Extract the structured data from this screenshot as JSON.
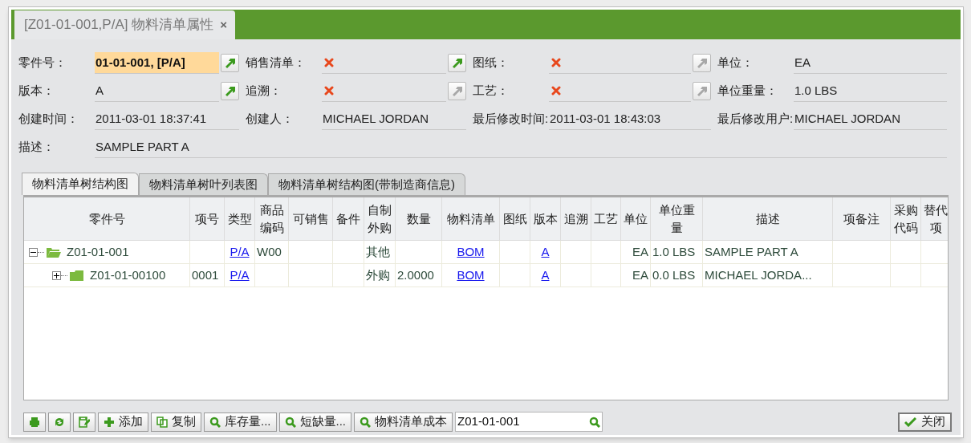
{
  "window": {
    "title": "[Z01-01-001,P/A] 物料清单属性",
    "close": "×"
  },
  "form": {
    "rows": [
      [
        {
          "label": "零件号：",
          "value": "01-01-001, [P/A]",
          "highlight": true,
          "link": {
            "disabled": false
          }
        },
        {
          "label": "销售清单：",
          "empty": true,
          "link": {
            "disabled": false
          }
        },
        {
          "label": "图纸：",
          "empty": true,
          "link": {
            "disabled": true
          }
        },
        {
          "label": "单位：",
          "value": "EA"
        }
      ],
      [
        {
          "label": "版本：",
          "value": "A",
          "link": {
            "disabled": false
          }
        },
        {
          "label": "追溯：",
          "empty": true,
          "link": {
            "disabled": true
          }
        },
        {
          "label": "工艺：",
          "empty": true,
          "link": {
            "disabled": true
          }
        },
        {
          "label": "单位重量：",
          "value": "1.0 LBS"
        }
      ],
      [
        {
          "label": "创建时间：",
          "value": "2011-03-01 18:37:41"
        },
        {
          "label": "创建人：",
          "value": "MICHAEL JORDAN"
        },
        {
          "label": "最后修改时间:",
          "value": "2011-03-01 18:43:03"
        },
        {
          "label": "最后修改用户:",
          "value": "MICHAEL JORDAN"
        }
      ],
      [
        {
          "label": "描述：",
          "value": "SAMPLE PART A"
        }
      ]
    ]
  },
  "tabs": [
    {
      "label": "物料清单树结构图",
      "selected": true
    },
    {
      "label": "物料清单树叶列表图",
      "selected": false
    },
    {
      "label": "物料清单树结构图(带制造商信息)",
      "selected": false
    }
  ],
  "table": {
    "columns": [
      "零件号",
      "项号",
      "类型",
      "商品编码",
      "可销售",
      "备件",
      "自制外购",
      "数量",
      "物料清单",
      "图纸",
      "版本",
      "追溯",
      "工艺",
      "单位",
      "单位重量",
      "描述",
      "项备注",
      "采购代码",
      "替代项"
    ],
    "rows": [
      {
        "expanded": true,
        "cells": [
          {
            "text": "Z01-01-001",
            "kind": "tree"
          },
          "",
          {
            "text": "P/A",
            "kind": "link"
          },
          {
            "text": "W00"
          },
          "",
          "",
          {
            "text": "其他"
          },
          "",
          {
            "text": "BOM",
            "kind": "link"
          },
          "",
          {
            "text": "A",
            "kind": "link"
          },
          "",
          "",
          {
            "text": "EA",
            "kind": "right"
          },
          {
            "text": "1.0 LBS"
          },
          {
            "text": "SAMPLE PART A"
          },
          "",
          "",
          ""
        ],
        "children": [
          {
            "expanded": false,
            "cells": [
              {
                "text": "Z01-01-00100",
                "kind": "tree"
              },
              {
                "text": "0001"
              },
              {
                "text": "P/A",
                "kind": "link"
              },
              "",
              "",
              "",
              {
                "text": "外购"
              },
              {
                "text": "2.0000"
              },
              {
                "text": "BOM",
                "kind": "link"
              },
              "",
              {
                "text": "A",
                "kind": "link"
              },
              "",
              "",
              {
                "text": "EA",
                "kind": "right"
              },
              {
                "text": "0.0 LBS"
              },
              {
                "text": "MICHAEL JORDA..."
              },
              "",
              "",
              ""
            ]
          }
        ]
      }
    ]
  },
  "toolbar": {
    "buttons": [
      {
        "kind": "print"
      },
      {
        "kind": "refresh"
      },
      {
        "kind": "edit"
      },
      {
        "kind": "add",
        "label": "添加"
      },
      {
        "kind": "copy",
        "label": "复制"
      },
      {
        "kind": "search",
        "label": "库存量..."
      },
      {
        "kind": "search",
        "label": "短缺量..."
      },
      {
        "kind": "search",
        "label": "物料清单成本"
      }
    ],
    "search": {
      "value": "Z01-01-001"
    },
    "close": {
      "label": "关闭"
    }
  }
}
